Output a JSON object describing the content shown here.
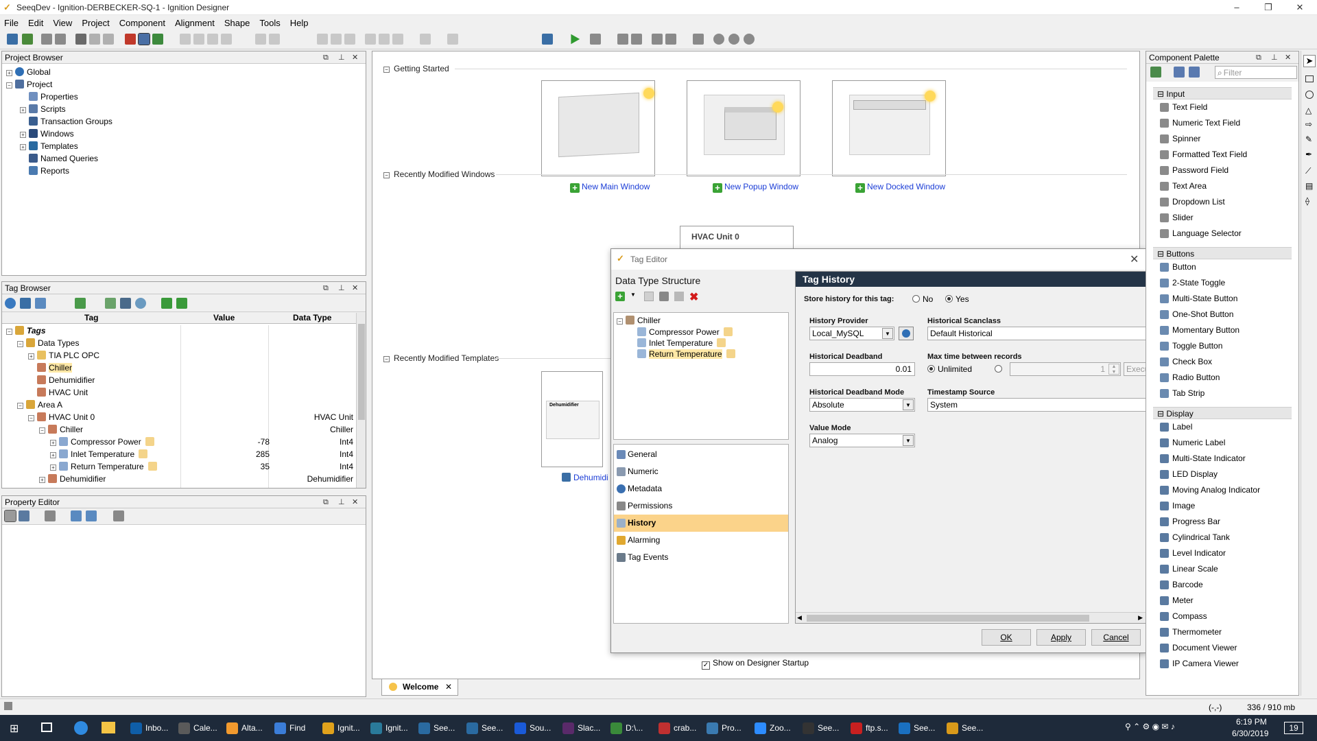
{
  "window": {
    "title": "SeeqDev - Ignition-DERBECKER-SQ-1 - Ignition Designer",
    "minimize": "–",
    "maximize": "❐",
    "close": "✕"
  },
  "menu": [
    "File",
    "Edit",
    "View",
    "Project",
    "Component",
    "Alignment",
    "Shape",
    "Tools",
    "Help"
  ],
  "project_browser": {
    "title": "Project Browser",
    "items": [
      {
        "label": "Global",
        "icon": "globe-icon",
        "indent": 0,
        "exp": "+"
      },
      {
        "label": "Project",
        "icon": "folder-icon",
        "indent": 0,
        "exp": "−"
      },
      {
        "label": "Properties",
        "icon": "properties-icon",
        "indent": 1,
        "exp": ""
      },
      {
        "label": "Scripts",
        "icon": "script-icon",
        "indent": 1,
        "exp": "+"
      },
      {
        "label": "Transaction Groups",
        "icon": "group-icon",
        "indent": 1,
        "exp": ""
      },
      {
        "label": "Windows",
        "icon": "window-icon",
        "indent": 1,
        "exp": "+"
      },
      {
        "label": "Templates",
        "icon": "template-icon",
        "indent": 1,
        "exp": "+"
      },
      {
        "label": "Named Queries",
        "icon": "query-icon",
        "indent": 1,
        "exp": ""
      },
      {
        "label": "Reports",
        "icon": "report-icon",
        "indent": 1,
        "exp": ""
      }
    ]
  },
  "tag_browser": {
    "title": "Tag Browser",
    "columns": [
      "Tag",
      "Value",
      "Data Type"
    ],
    "rows": [
      {
        "tag": "Tags",
        "value": "",
        "type": "",
        "indent": 0,
        "exp": "−",
        "bold": true
      },
      {
        "tag": "Data Types",
        "value": "",
        "type": "",
        "indent": 1,
        "exp": "−"
      },
      {
        "tag": "TIA PLC OPC",
        "value": "",
        "type": "",
        "indent": 2,
        "exp": "+"
      },
      {
        "tag": "Chiller",
        "value": "",
        "type": "",
        "indent": 2,
        "exp": "",
        "selected": true
      },
      {
        "tag": "Dehumidifier",
        "value": "",
        "type": "",
        "indent": 2,
        "exp": ""
      },
      {
        "tag": "HVAC Unit",
        "value": "",
        "type": "",
        "indent": 2,
        "exp": ""
      },
      {
        "tag": "Area A",
        "value": "",
        "type": "",
        "indent": 1,
        "exp": "−"
      },
      {
        "tag": "HVAC Unit 0",
        "value": "",
        "type": "HVAC Unit",
        "indent": 2,
        "exp": "−"
      },
      {
        "tag": "Chiller",
        "value": "",
        "type": "Chiller",
        "indent": 3,
        "exp": "−"
      },
      {
        "tag": "Compressor Power",
        "value": "-78",
        "type": "Int4",
        "indent": 4,
        "exp": "+"
      },
      {
        "tag": "Inlet Temperature",
        "value": "285",
        "type": "Int4",
        "indent": 4,
        "exp": "+"
      },
      {
        "tag": "Return Temperature",
        "value": "35",
        "type": "Int4",
        "indent": 4,
        "exp": "+"
      },
      {
        "tag": "Dehumidifier",
        "value": "",
        "type": "Dehumidifier",
        "indent": 3,
        "exp": "+"
      }
    ]
  },
  "property_editor": {
    "title": "Property Editor"
  },
  "welcome": {
    "getting_started": "Getting Started",
    "new_main": "New Main Window",
    "new_popup": "New Popup Window",
    "new_docked": "New Docked Window",
    "recent_windows": "Recently Modified Windows",
    "recent_window_name": "HVAC Unit 0",
    "recent_templates": "Recently Modified Templates",
    "recent_template_thumb": "Dehumidifier",
    "recent_template_name": "Dehumidi",
    "show_startup": "Show on Designer Startup",
    "tab": "Welcome"
  },
  "tag_editor": {
    "title": "Tag Editor",
    "structure_title": "Data Type Structure",
    "tree": [
      {
        "label": "Chiller",
        "indent": 0
      },
      {
        "label": "Compressor Power",
        "indent": 1
      },
      {
        "label": "Inlet Temperature",
        "indent": 1
      },
      {
        "label": "Return Temperature",
        "indent": 1,
        "selected": true
      }
    ],
    "nav": [
      {
        "label": "General"
      },
      {
        "label": "Numeric"
      },
      {
        "label": "Metadata"
      },
      {
        "label": "Permissions"
      },
      {
        "label": "History",
        "selected": true
      },
      {
        "label": "Alarming"
      },
      {
        "label": "Tag Events"
      }
    ],
    "section_title": "Tag History",
    "store_history_label": "Store history for this tag:",
    "no": "No",
    "yes": "Yes",
    "history_provider_label": "History Provider",
    "history_provider": "Local_MySQL",
    "scanclass_label": "Historical Scanclass",
    "scanclass": "Default Historical",
    "deadband_label": "Historical Deadband",
    "deadband": "0.01",
    "max_time_label": "Max time between records",
    "unlimited": "Unlimited",
    "max_time_value": "1",
    "max_time_unit": "Execu",
    "deadband_mode_label": "Historical Deadband Mode",
    "deadband_mode": "Absolute",
    "timestamp_label": "Timestamp Source",
    "timestamp": "System",
    "value_mode_label": "Value Mode",
    "value_mode": "Analog",
    "ok": "OK",
    "apply": "Apply",
    "cancel": "Cancel"
  },
  "palette": {
    "title": "Component Palette",
    "filter_placeholder": "Filter",
    "sections": [
      {
        "name": "Input",
        "items": [
          "Text Field",
          "Numeric Text Field",
          "Spinner",
          "Formatted Text Field",
          "Password Field",
          "Text Area",
          "Dropdown List",
          "Slider",
          "Language Selector"
        ]
      },
      {
        "name": "Buttons",
        "items": [
          "Button",
          "2-State Toggle",
          "Multi-State Button",
          "One-Shot Button",
          "Momentary Button",
          "Toggle Button",
          "Check Box",
          "Radio Button",
          "Tab Strip"
        ]
      },
      {
        "name": "Display",
        "items": [
          "Label",
          "Numeric Label",
          "Multi-State Indicator",
          "LED Display",
          "Moving Analog Indicator",
          "Image",
          "Progress Bar",
          "Cylindrical Tank",
          "Level Indicator",
          "Linear Scale",
          "Barcode",
          "Meter",
          "Compass",
          "Thermometer",
          "Document Viewer",
          "IP Camera Viewer"
        ]
      }
    ]
  },
  "status": {
    "coords": "(-,-)",
    "memory": "336 / 910 mb"
  },
  "taskbar": {
    "items": [
      "Inbo...",
      "Cale...",
      "Alta...",
      "Find",
      "Ignit...",
      "",
      "",
      "",
      "Ignit...",
      "See...",
      "See...",
      "Sou...",
      "Slac...",
      "D:\\...",
      "crab...",
      "Pro...",
      "Zoo...",
      "See...",
      "ftp.s...",
      "See...",
      "See..."
    ],
    "time": "6:19 PM",
    "date": "6/30/2019",
    "notif": "19"
  }
}
